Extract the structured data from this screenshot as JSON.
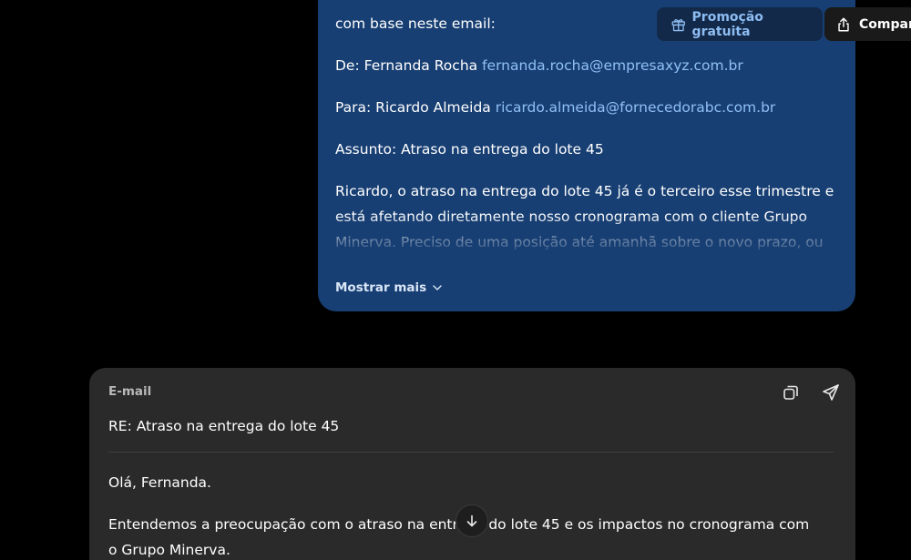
{
  "user_message": {
    "intro": "com base neste email:",
    "from_label": "De: Fernanda Rocha",
    "from_email": "fernanda.rocha@empresaxyz.com.br",
    "to_label": "Para: Ricardo Almeida",
    "to_email": "ricardo.almeida@fornecedorabc.com.br",
    "subject_line": "Assunto: Atraso na entrega do lote 45",
    "body": "Ricardo, o atraso na entrega do lote 45 já é o terceiro esse trimestre e está afetando diretamente nosso cronograma com o cliente Grupo Minerva. Preciso de uma posição até amanhã sobre o novo prazo, ou seremos obrigados a revisar o contrato de fornecimento para o",
    "show_more_label": "Mostrar mais"
  },
  "header": {
    "promo_label": "Promoção gratuita",
    "share_label": "Compar"
  },
  "email_card": {
    "label": "E-mail",
    "subject": "RE: Atraso na entrega do lote 45",
    "greeting": "Olá, Fernanda.",
    "paragraph1": "Entendemos a preocupação com o atraso na entrega do lote 45 e os impactos no cronograma com o Grupo Minerva."
  },
  "colors": {
    "user_bubble": "#183f73",
    "link": "#8fc0f5",
    "card_bg": "#2a2a2a",
    "page_bg": "#000000"
  }
}
